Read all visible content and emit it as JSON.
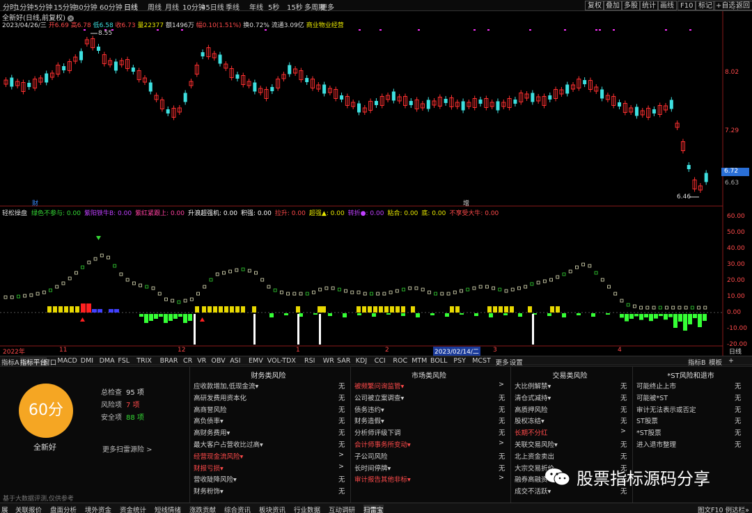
{
  "toolbar": {
    "periods": [
      "分时",
      "1分钟",
      "5分钟",
      "15分钟",
      "30分钟",
      "60分钟",
      "日线",
      "周线",
      "月线",
      "10分钟",
      "45日线",
      "季线",
      "年线",
      "5秒",
      "15秒",
      "多周期",
      "更多"
    ],
    "tools": [
      "复权",
      "叠加",
      "多股",
      "统计",
      "画线",
      "F10",
      "标记",
      "+自选",
      "返回"
    ]
  },
  "stock": {
    "title": "全新好(日线,前复权)",
    "date": "2023/04/26/三",
    "open": "开6.69",
    "high": "高6.78",
    "low": "低6.58",
    "close": "收6.73",
    "volume": "量22377",
    "amount": "额1496万",
    "change": "幅0.10(1.51%)",
    "turnover": "换0.72%",
    "float": "流通3.09亿",
    "sector": "商业物业经营"
  },
  "price_axis": {
    "labels": [
      "8.02",
      "7.29",
      "6.63"
    ],
    "current": "6.72",
    "high_mark": "8.55",
    "low_mark": "6.46",
    "markers": [
      "财",
      "增"
    ]
  },
  "indicator": {
    "name": "轻松操盘",
    "items": [
      {
        "t": "绿色不参与: 0.00",
        "c": "#35d935"
      },
      {
        "t": "紫阳铁牛B: 0.00",
        "c": "#c040ff"
      },
      {
        "t": "紫红紧跟上: 0.00",
        "c": "#ff40a0"
      },
      {
        "t": "升浪超强机: 0.00",
        "c": "#ffffff"
      },
      {
        "t": "积强: 0.00",
        "c": "#ffffff"
      },
      {
        "t": "拉升: 0.00",
        "c": "#ff4a4a"
      },
      {
        "t": "超强▲: 0.00",
        "c": "#e8e800"
      },
      {
        "t": "转折●: 0.00",
        "c": "#c040ff"
      },
      {
        "t": "粘合: 0.00",
        "c": "#e8e800"
      },
      {
        "t": "底: 0.00",
        "c": "#e8e800"
      },
      {
        "t": "不享受大牛: 0.00",
        "c": "#ff4a4a"
      }
    ],
    "axis": [
      "60.00",
      "50.00",
      "40.00",
      "30.00",
      "20.00",
      "10.00",
      "0.00",
      "-10.00",
      "-20.00"
    ]
  },
  "time_axis": {
    "labels": [
      "2022年",
      "11",
      "12",
      "1",
      "2",
      "2023/02/14/二",
      "3",
      "4"
    ],
    "right": "日线"
  },
  "tabs": [
    "指标A",
    "指标平台",
    "窗口",
    "MACD",
    "DMI",
    "DMA",
    "FSL",
    "TRIX",
    "BRAR",
    "CR",
    "VR",
    "OBV",
    "ASI",
    "EMV",
    "VOL-TDX",
    "RSI",
    "WR",
    "SAR",
    "KDJ",
    "CCI",
    "ROC",
    "MTM",
    "BOLL",
    "PSY",
    "MCST",
    "更多",
    "设置"
  ],
  "tabs_right": [
    "指标B",
    "模板",
    "+"
  ],
  "risk": {
    "score": "60分",
    "total_label": "总检查",
    "total": "95 项",
    "risk_label": "风险项",
    "risk": "7 项",
    "safe_label": "安全项",
    "safe": "88 项",
    "name": "全新好",
    "more": "更多扫雷源险 >",
    "disclaimer": "基于大数据评测,仅供参考"
  },
  "columns": [
    {
      "title": "财务类风险",
      "rows": [
        {
          "l": "应收款增加,低现金流▾",
          "v": "无",
          "r": false
        },
        {
          "l": "高研发费用资本化",
          "v": "无",
          "r": false
        },
        {
          "l": "高商誉风险",
          "v": "无",
          "r": false
        },
        {
          "l": "高负债率▾",
          "v": "无",
          "r": false
        },
        {
          "l": "高财务费用▾",
          "v": "无",
          "r": false
        },
        {
          "l": "最大客户占营收比过高▾",
          "v": "无",
          "r": false
        },
        {
          "l": "经营现金流风险▾",
          "v": ">",
          "r": true
        },
        {
          "l": "财报亏损▾",
          "v": ">",
          "r": true
        },
        {
          "l": "营收陡降风险▾",
          "v": "无",
          "r": false
        },
        {
          "l": "财务粉饰▾",
          "v": "无",
          "r": false
        }
      ]
    },
    {
      "title": "市场类风险",
      "rows": [
        {
          "l": "被频繁问询监管▾",
          "v": ">",
          "r": true
        },
        {
          "l": "公司被立案调查▾",
          "v": "无",
          "r": false
        },
        {
          "l": "债务违约▾",
          "v": "无",
          "r": false
        },
        {
          "l": "财务造假▾",
          "v": "无",
          "r": false
        },
        {
          "l": "分析师评级下调",
          "v": "无",
          "r": false
        },
        {
          "l": "会计师事务所变动▾",
          "v": ">",
          "r": true
        },
        {
          "l": "子公司风险",
          "v": "无",
          "r": false
        },
        {
          "l": "长时间停牌▾",
          "v": "无",
          "r": false
        },
        {
          "l": "审计报告其他非标▾",
          "v": ">",
          "r": true
        }
      ]
    },
    {
      "title": "交易类风险",
      "rows": [
        {
          "l": "大比例解禁▾",
          "v": "无",
          "r": false
        },
        {
          "l": "清仓式减持▾",
          "v": "无",
          "r": false
        },
        {
          "l": "高质押风险",
          "v": "无",
          "r": false
        },
        {
          "l": "股权冻结▾",
          "v": "无",
          "r": false
        },
        {
          "l": "长期不分红",
          "v": ">",
          "r": true
        },
        {
          "l": "关联交易风险▾",
          "v": "无",
          "r": false
        },
        {
          "l": "北上资金卖出",
          "v": "无",
          "r": false
        },
        {
          "l": "大宗交易折价",
          "v": "无",
          "r": false
        },
        {
          "l": "融券高融资",
          "v": "无",
          "r": false
        },
        {
          "l": "成交不活跃▾",
          "v": "无",
          "r": false
        }
      ]
    },
    {
      "title": "*ST风险和退市",
      "rows": [
        {
          "l": "可能终止上市",
          "v": "无",
          "r": false
        },
        {
          "l": "可能被*ST",
          "v": "无",
          "r": false
        },
        {
          "l": "审计无法表示或否定",
          "v": "无",
          "r": false
        },
        {
          "l": "ST股票",
          "v": "无",
          "r": false
        },
        {
          "l": "*ST股票",
          "v": "无",
          "r": false
        },
        {
          "l": "进入退市整理",
          "v": "无",
          "r": false
        }
      ]
    }
  ],
  "bottom": [
    "展",
    "关联报价",
    "盘面分析",
    "境外资金",
    "资金统计",
    "短线情绪",
    "涨跌贡献",
    "综合资讯",
    "板块资讯",
    "行业数据",
    "互动调研",
    "扫雷宝"
  ],
  "bottom_right": "图文F10 例达栏»",
  "watermark": "股票指标源码分享"
}
